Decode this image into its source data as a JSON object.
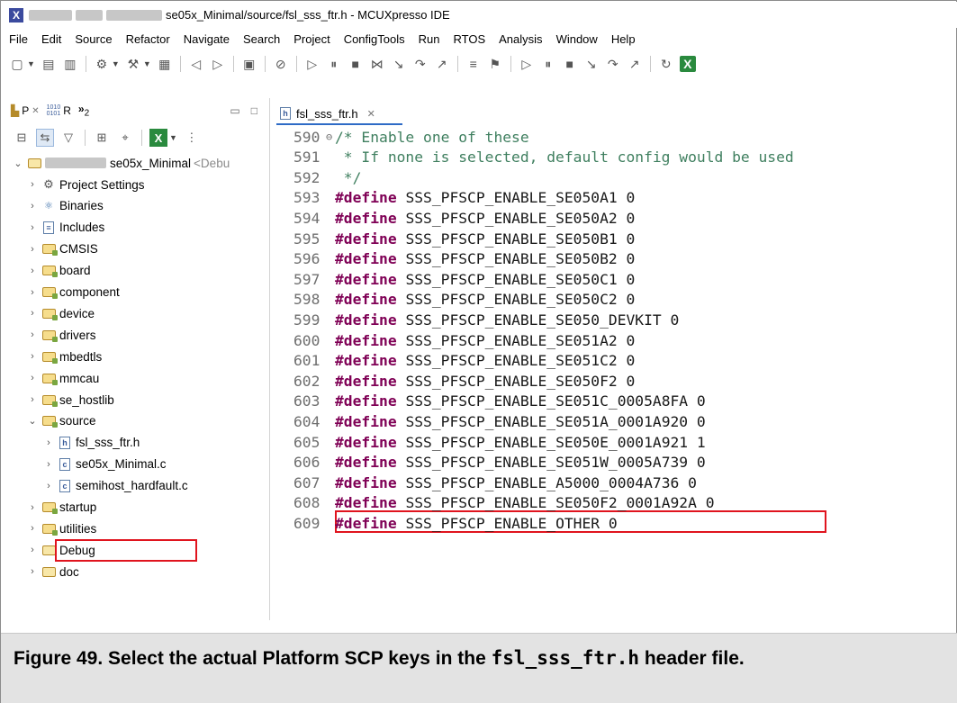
{
  "window": {
    "title_suffix": "se05x_Minimal/source/fsl_sss_ftr.h - MCUXpresso IDE",
    "logo_glyph": "X"
  },
  "menu": [
    "File",
    "Edit",
    "Source",
    "Refactor",
    "Navigate",
    "Search",
    "Project",
    "ConfigTools",
    "Run",
    "RTOS",
    "Analysis",
    "Window",
    "Help"
  ],
  "left_tabs": {
    "project_tab": "P",
    "registers_tab": "R",
    "overflow": "»",
    "overflow_count": "2"
  },
  "tree": {
    "project_name": "se05x_Minimal",
    "project_suffix": "<Debu",
    "items": [
      {
        "label": "Project Settings",
        "icon": "gear-icon"
      },
      {
        "label": "Binaries",
        "icon": "binaries-icon"
      },
      {
        "label": "Includes",
        "icon": "includes-icon"
      },
      {
        "label": "CMSIS",
        "icon": "source-folder-icon"
      },
      {
        "label": "board",
        "icon": "source-folder-icon"
      },
      {
        "label": "component",
        "icon": "source-folder-icon"
      },
      {
        "label": "device",
        "icon": "source-folder-icon"
      },
      {
        "label": "drivers",
        "icon": "source-folder-icon"
      },
      {
        "label": "mbedtls",
        "icon": "source-folder-icon"
      },
      {
        "label": "mmcau",
        "icon": "source-folder-icon"
      },
      {
        "label": "se_hostlib",
        "icon": "source-folder-icon"
      },
      {
        "label": "source",
        "icon": "source-folder-icon"
      },
      {
        "label": "fsl_sss_ftr.h",
        "icon": "header-file-icon"
      },
      {
        "label": "se05x_Minimal.c",
        "icon": "c-file-icon"
      },
      {
        "label": "semihost_hardfault.c",
        "icon": "c-file-icon"
      },
      {
        "label": "startup",
        "icon": "source-folder-icon"
      },
      {
        "label": "utilities",
        "icon": "source-folder-icon"
      },
      {
        "label": "Debug",
        "icon": "folder-icon"
      },
      {
        "label": "doc",
        "icon": "folder-icon"
      }
    ]
  },
  "editor": {
    "tab_label": "fsl_sss_ftr.h",
    "tab_close": "✕",
    "keyword": "#define",
    "lines": [
      {
        "n": "590",
        "fold": "⊖",
        "comment": "/* Enable one of these"
      },
      {
        "n": "591",
        "comment": " * If none is selected, default config would be used"
      },
      {
        "n": "592",
        "comment": " */"
      },
      {
        "n": "593",
        "macro": "SSS_PFSCP_ENABLE_SE050A1 0"
      },
      {
        "n": "594",
        "macro": "SSS_PFSCP_ENABLE_SE050A2 0"
      },
      {
        "n": "595",
        "macro": "SSS_PFSCP_ENABLE_SE050B1 0"
      },
      {
        "n": "596",
        "macro": "SSS_PFSCP_ENABLE_SE050B2 0"
      },
      {
        "n": "597",
        "macro": "SSS_PFSCP_ENABLE_SE050C1 0"
      },
      {
        "n": "598",
        "macro": "SSS_PFSCP_ENABLE_SE050C2 0"
      },
      {
        "n": "599",
        "macro": "SSS_PFSCP_ENABLE_SE050_DEVKIT 0"
      },
      {
        "n": "600",
        "macro": "SSS_PFSCP_ENABLE_SE051A2 0"
      },
      {
        "n": "601",
        "macro": "SSS_PFSCP_ENABLE_SE051C2 0"
      },
      {
        "n": "602",
        "macro": "SSS_PFSCP_ENABLE_SE050F2 0"
      },
      {
        "n": "603",
        "macro": "SSS_PFSCP_ENABLE_SE051C_0005A8FA 0"
      },
      {
        "n": "604",
        "macro": "SSS_PFSCP_ENABLE_SE051A_0001A920 0"
      },
      {
        "n": "605",
        "macro": "SSS_PFSCP_ENABLE_SE050E_0001A921 1"
      },
      {
        "n": "606",
        "macro": "SSS_PFSCP_ENABLE_SE051W_0005A739 0"
      },
      {
        "n": "607",
        "macro": "SSS_PFSCP_ENABLE_A5000_0004A736 0"
      },
      {
        "n": "608",
        "macro": "SSS_PFSCP_ENABLE_SE050F2_0001A92A 0"
      },
      {
        "n": "609",
        "macro": "SSS_PFSCP_ENABLE_OTHER 0"
      }
    ]
  },
  "caption": {
    "prefix": "Figure 49.   Select the actual Platform SCP keys in the ",
    "filename": "fsl_sss_ftr.h",
    "suffix": " header file."
  },
  "colors": {
    "highlight": "#e0141e",
    "keyword": "#7f0055",
    "comment": "#3f7f5f"
  }
}
